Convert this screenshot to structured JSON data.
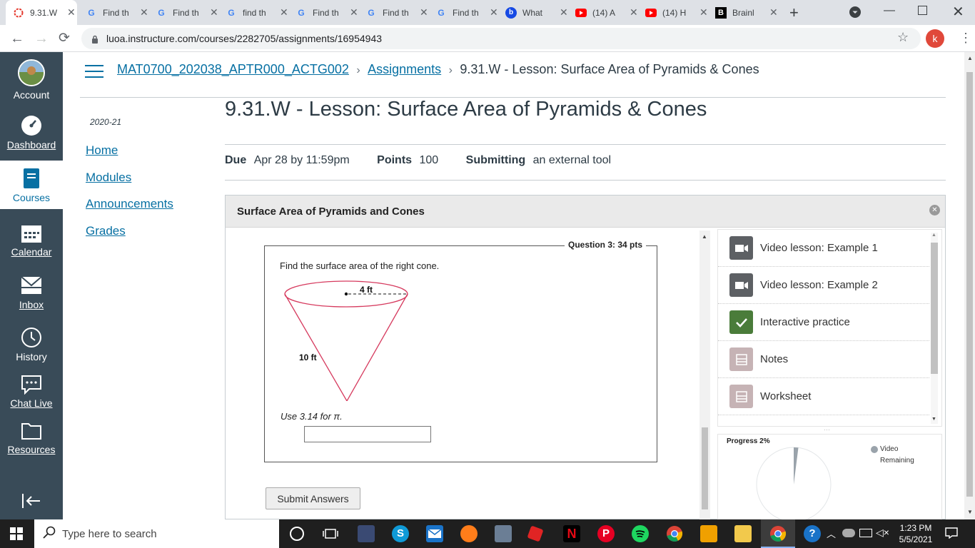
{
  "browser": {
    "tabs": [
      {
        "label": "9.31.W",
        "icon": "canvas-icon",
        "active": true
      },
      {
        "label": "Find th",
        "icon": "google-icon"
      },
      {
        "label": "Find th",
        "icon": "google-icon"
      },
      {
        "label": "find th",
        "icon": "google-icon"
      },
      {
        "label": "Find th",
        "icon": "google-icon"
      },
      {
        "label": "Find th",
        "icon": "google-icon"
      },
      {
        "label": "Find th",
        "icon": "google-icon"
      },
      {
        "label": "What",
        "icon": "bing-icon"
      },
      {
        "label": "(14) A",
        "icon": "youtube-icon"
      },
      {
        "label": "(14) H",
        "icon": "youtube-icon"
      },
      {
        "label": "Brainl",
        "icon": "brainly-icon"
      }
    ],
    "url": "luoa.instructure.com/courses/2282705/assignments/16954943",
    "profile_initial": "k"
  },
  "global_nav": {
    "items": [
      {
        "label": "Account",
        "icon": "avatar-icon"
      },
      {
        "label": "Dashboard",
        "icon": "dashboard-icon"
      },
      {
        "label": "Courses",
        "icon": "courses-icon"
      },
      {
        "label": "Calendar",
        "icon": "calendar-icon"
      },
      {
        "label": "Inbox",
        "icon": "inbox-icon"
      },
      {
        "label": "History",
        "icon": "history-icon"
      },
      {
        "label": "Chat Live",
        "icon": "chat-icon"
      },
      {
        "label": "Resources",
        "icon": "folder-icon"
      }
    ]
  },
  "breadcrumb": {
    "course": "MAT0700_202038_APTR000_ACTG002",
    "section": "Assignments",
    "current": "9.31.W - Lesson: Surface Area of Pyramids & Cones"
  },
  "course_nav": {
    "term": "2020-21",
    "links": [
      "Home",
      "Modules",
      "Announcements",
      "Grades"
    ]
  },
  "assignment": {
    "title": "9.31.W - Lesson: Surface Area of Pyramids & Cones",
    "due_label": "Due",
    "due_value": "Apr 28 by 11:59pm",
    "points_label": "Points",
    "points_value": "100",
    "submitting_label": "Submitting",
    "submitting_value": "an external tool"
  },
  "tool": {
    "header": "Surface Area of Pyramids and Cones",
    "question_legend": "Question 3: 34 pts",
    "question_text": "Find the surface area of the right cone.",
    "radius_label": "4 ft",
    "slant_label": "10 ft",
    "hint": "Use 3.14 for π.",
    "answer_value": "",
    "submit_label": "Submit Answers",
    "sidebar": [
      {
        "label": "Video lesson: Example 1",
        "icon": "video-icon",
        "color": "#5d6064"
      },
      {
        "label": "Video lesson: Example 2",
        "icon": "video-icon",
        "color": "#5d6064"
      },
      {
        "label": "Interactive practice",
        "icon": "check-icon",
        "color": "#4a7c3a"
      },
      {
        "label": "Notes",
        "icon": "document-icon",
        "color": "#c6b3b5"
      },
      {
        "label": "Worksheet",
        "icon": "document-icon",
        "color": "#c6b3b5"
      }
    ],
    "progress_label": "Progress 2%",
    "progress_fraction": 0.02,
    "legend_video": "Video",
    "legend_remaining": "Remaining"
  },
  "taskbar": {
    "search_placeholder": "Type here to search",
    "time": "1:23 PM",
    "date": "5/5/2021"
  }
}
